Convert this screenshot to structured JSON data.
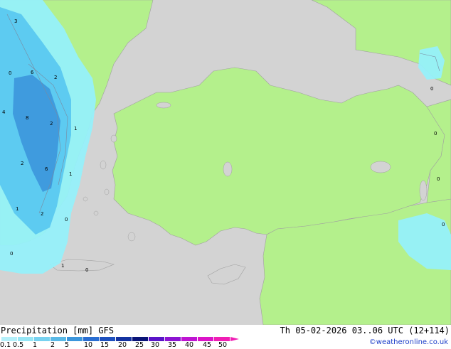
{
  "map": {
    "contour_labels": [
      "3",
      "0",
      "6",
      "2",
      "4",
      "8",
      "2",
      "1",
      "2",
      "6",
      "1",
      "1",
      "2",
      "0",
      "0",
      "1",
      "0",
      "0",
      "0",
      "0",
      "0"
    ]
  },
  "footer": {
    "title": "Precipitation [mm] GFS",
    "timestamp": "Th 05-02-2026 03..06 UTC (12+114)",
    "credit": "©weatheronline.co.uk"
  },
  "legend": {
    "ticks": [
      "0.1",
      "0.5",
      "1",
      "2",
      "5",
      "10",
      "15",
      "20",
      "25",
      "30",
      "35",
      "40",
      "45",
      "50"
    ],
    "colors": [
      "#b4f0fa",
      "#96e6f5",
      "#78d2f0",
      "#5ab9e6",
      "#3c96dc",
      "#2a6ed2",
      "#1e50be",
      "#1432a0",
      "#0a1478",
      "#5a14c8",
      "#8c14d2",
      "#be14d2",
      "#dc14c8",
      "#f01eb4"
    ]
  },
  "colors": {
    "land": "#b4f08c",
    "sea": "#d3d3d3",
    "precip_light": "#96f0fa",
    "precip_mid": "#5ac8f0",
    "precip_heavy": "#3c96dc"
  }
}
